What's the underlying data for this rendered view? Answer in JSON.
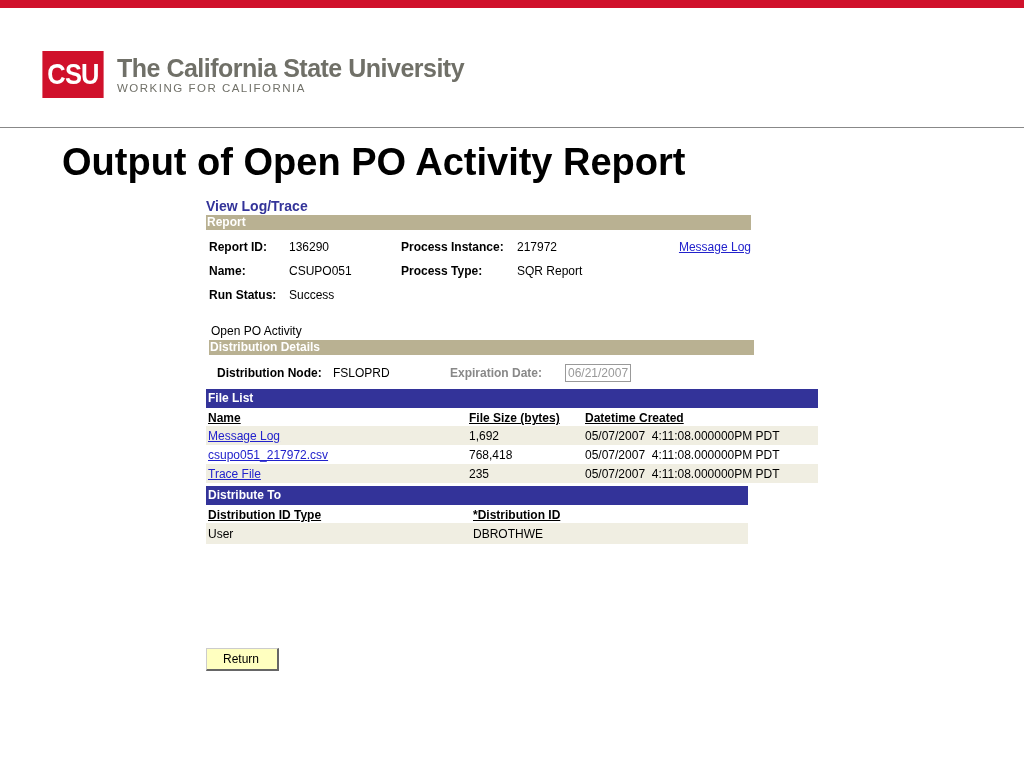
{
  "logo": {
    "mark": "CSU",
    "name": "The California State University",
    "tagline": "WORKING FOR CALIFORNIA"
  },
  "slide_title": "Output of Open PO Activity Report",
  "page_title": "View Log/Trace",
  "report": {
    "header": "Report",
    "fields": [
      {
        "label": "Report ID:",
        "value": "136290"
      },
      {
        "label": "Process Instance:",
        "value": "217972"
      },
      {
        "label": "Name:",
        "value": "CSUPO051"
      },
      {
        "label": "Process Type:",
        "value": "SQR Report"
      },
      {
        "label": "Run Status:",
        "value": "Success"
      }
    ],
    "link": "Message Log",
    "description": "Open PO Activity"
  },
  "distribution_details": {
    "header": "Distribution Details",
    "node_label": "Distribution Node:",
    "node_value": "FSLOPRD",
    "expiration_label": "Expiration Date:",
    "expiration_value": "06/21/2007",
    "expiration_disabled": true
  },
  "file_list": {
    "header": "File List",
    "columns": [
      "Name",
      "File Size (bytes)",
      "Datetime Created"
    ],
    "rows": [
      {
        "name": "Message Log",
        "size": "1,692",
        "created": "05/07/2007  4:11:08.000000PM PDT"
      },
      {
        "name": "csupo051_217972.csv",
        "size": "768,418",
        "created": "05/07/2007  4:11:08.000000PM PDT"
      },
      {
        "name": "Trace File",
        "size": "235",
        "created": "05/07/2007  4:11:08.000000PM PDT"
      }
    ]
  },
  "distribute_to": {
    "header": "Distribute To",
    "columns": [
      "Distribution ID Type",
      "*Distribution ID"
    ],
    "rows": [
      {
        "type": "User",
        "id": "DBROTHWE"
      }
    ]
  },
  "return_button": "Return"
}
